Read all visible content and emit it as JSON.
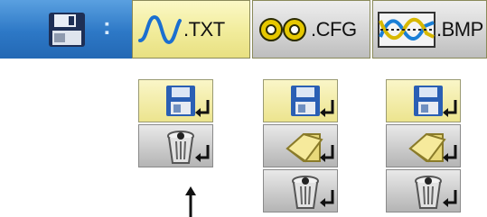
{
  "toolbar": {
    "colon": ":",
    "tabs": [
      {
        "id": "txt",
        "label": ".TXT",
        "icon": "sine-wave-icon",
        "selected": true
      },
      {
        "id": "cfg",
        "label": ".CFG",
        "icon": "gears-icon",
        "selected": false
      },
      {
        "id": "bmp",
        "label": ".BMP",
        "icon": "waveform-image-icon",
        "selected": false
      }
    ],
    "save_icon": "floppy-disk-icon"
  },
  "menus": [
    {
      "items": [
        "save",
        "delete"
      ]
    },
    {
      "items": [
        "save",
        "open-folder",
        "delete"
      ]
    },
    {
      "items": [
        "save",
        "open-folder",
        "delete"
      ]
    }
  ],
  "colors": {
    "blue_bar": "#2d78c6",
    "selected_tab": "#f2ed9e",
    "unselected_tab": "#d2d2d2",
    "floppy": "#2a5fb4"
  }
}
